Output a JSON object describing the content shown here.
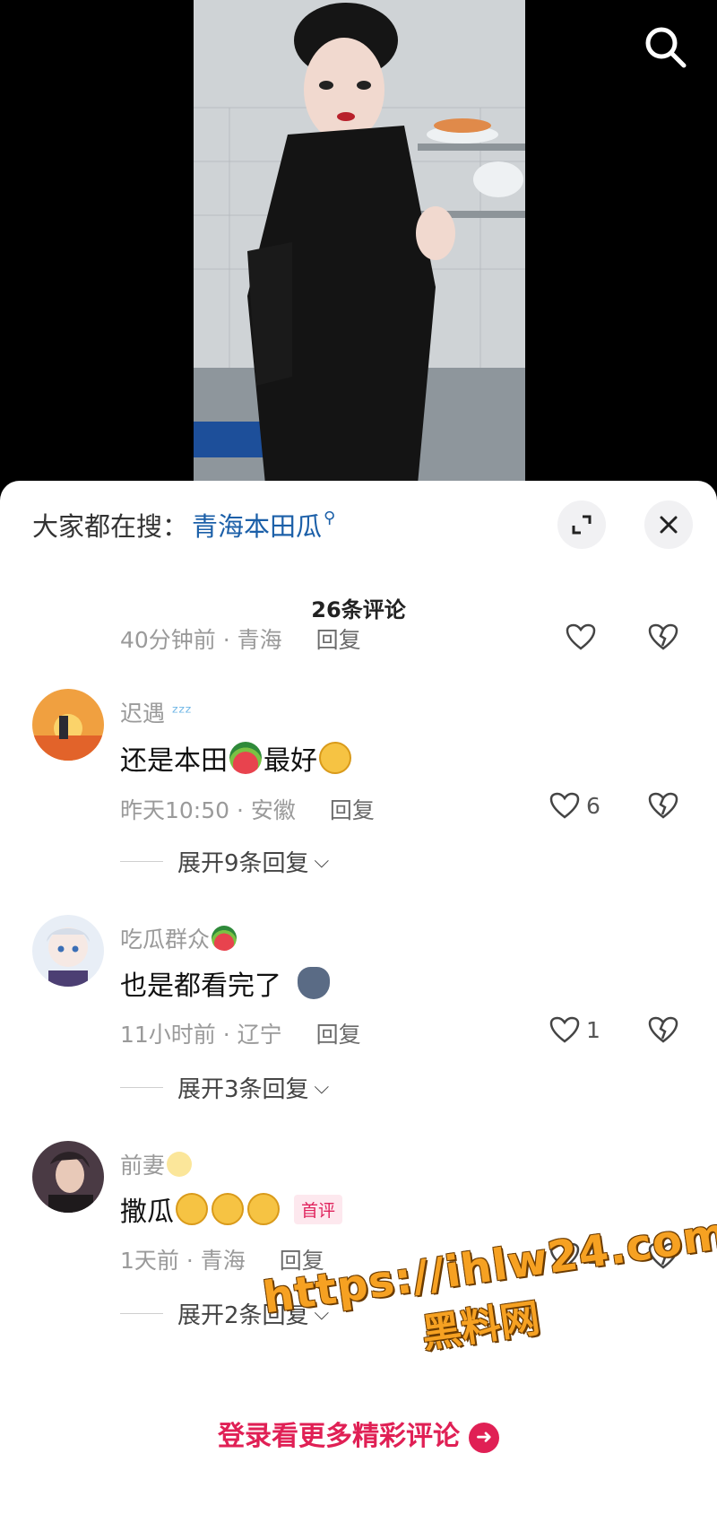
{
  "header": {
    "hot_search_label": "大家都在搜：",
    "hot_search_term": "青海本田瓜"
  },
  "comments_title": "26条评论",
  "partial_comment": {
    "time": "40分钟前 · 青海",
    "reply_label": "回复"
  },
  "comments": [
    {
      "username": "迟遇",
      "text_a": "还是本田",
      "text_b": "最好",
      "time": "昨天10:50 · 安徽",
      "reply_label": "回复",
      "likes": "6",
      "expand_label": "展开9条回复"
    },
    {
      "username": "吃瓜群众",
      "text_a": "也是都看完了",
      "time": "11小时前 · 辽宁",
      "reply_label": "回复",
      "likes": "1",
      "expand_label": "展开3条回复"
    },
    {
      "username": "前妻",
      "text_a": "撒瓜",
      "badge": "首评",
      "time": "1天前 · 青海",
      "reply_label": "回复",
      "likes": "1",
      "expand_label": "展开2条回复"
    }
  ],
  "login_prompt": "登录看更多精彩评论",
  "watermark": {
    "url": "https://ihlw24.com",
    "name": "黑料网"
  },
  "colors": {
    "accent": "#e02055",
    "link": "#1b5fa8",
    "watermark": "#f6a122"
  }
}
